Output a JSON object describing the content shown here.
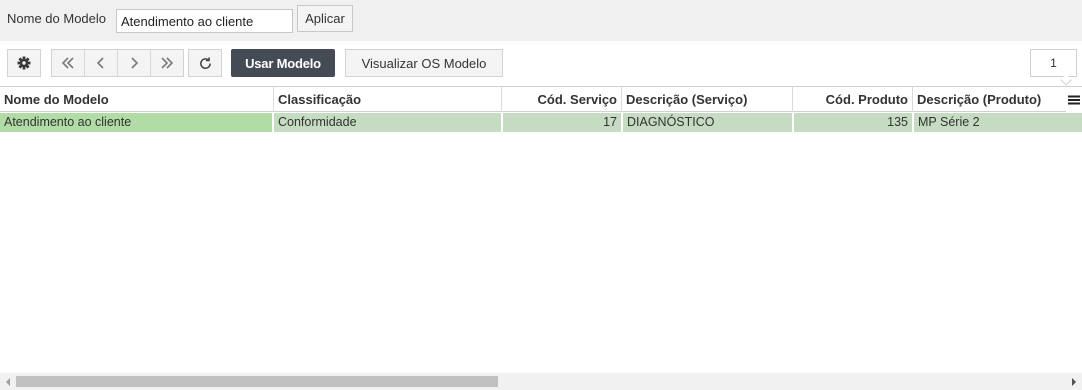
{
  "filter": {
    "label": "Nome do Modelo",
    "value": "Atendimento ao cliente",
    "apply_label": "Aplicar"
  },
  "toolbar": {
    "settings_icon": "gear-icon",
    "nav_icons": [
      "double-chevron-left-icon",
      "chevron-left-icon",
      "chevron-right-icon",
      "double-chevron-right-icon"
    ],
    "refresh_icon": "refresh-icon",
    "use_label": "Usar Modelo",
    "view_label": "Visualizar OS Modelo",
    "page_number": "1",
    "use_button_color": "#454b55"
  },
  "grid": {
    "columns": [
      "Nome do Modelo",
      "Classificação",
      "Cód. Serviço",
      "Descrição (Serviço)",
      "Cód. Produto",
      "Descrição (Produto)"
    ],
    "rows": [
      [
        "Atendimento ao cliente",
        "Conformidade",
        "17",
        "DIAGNÓSTICO",
        "135",
        "MP Série 2"
      ]
    ],
    "selected_row_color": "#c6dcc2",
    "column_menu_icon": "menu-lines-icon"
  },
  "scrollbar": {
    "left_icon": "scroll-left-icon",
    "right_icon": "scroll-right-icon"
  }
}
